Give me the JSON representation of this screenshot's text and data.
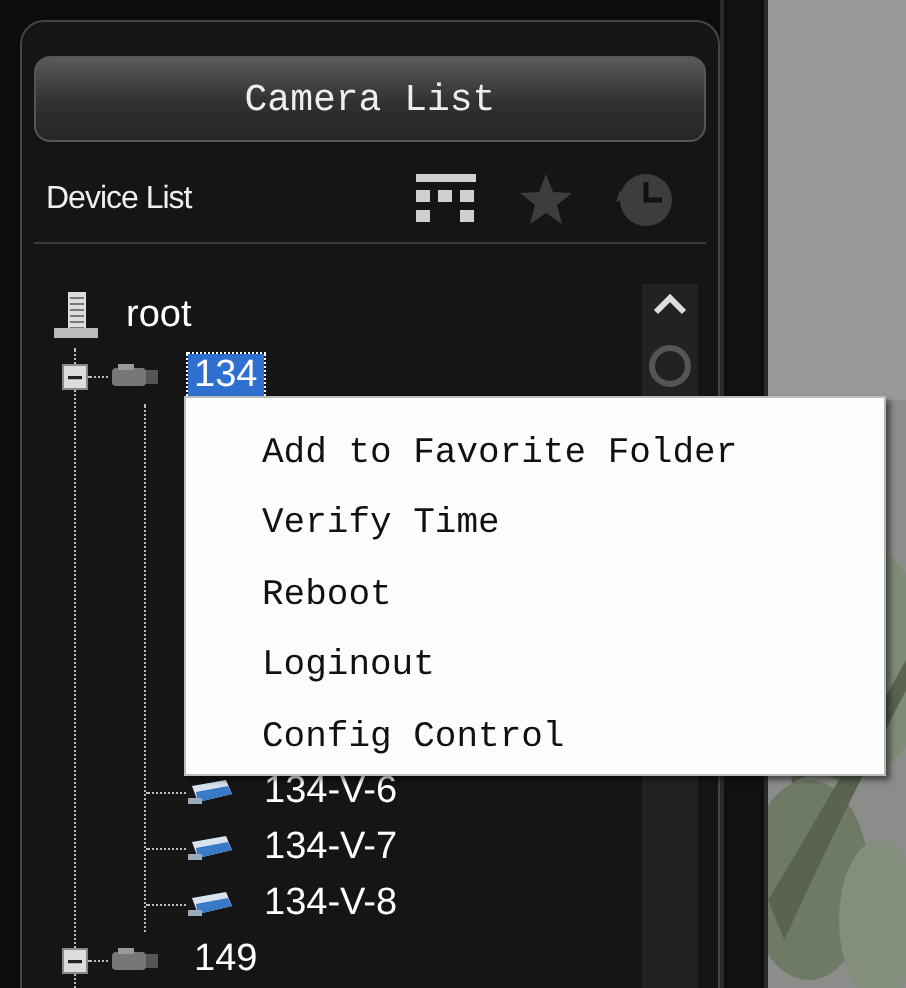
{
  "header_button": "Camera List",
  "device_list": {
    "title": "Device List",
    "views": [
      {
        "kind": "grid",
        "selected": true
      },
      {
        "kind": "star",
        "selected": false
      },
      {
        "kind": "clock",
        "selected": false
      }
    ]
  },
  "tree": [
    {
      "label": "root",
      "kind": "root",
      "selected": false,
      "children": [
        {
          "label": "134",
          "kind": "device",
          "expanded": true,
          "selected": true,
          "children": [
            {
              "label": "134-V-6",
              "kind": "channel",
              "selected": false
            },
            {
              "label": "134-V-7",
              "kind": "channel",
              "selected": false
            },
            {
              "label": "134-V-8",
              "kind": "channel",
              "selected": false
            }
          ]
        },
        {
          "label": "149",
          "kind": "device",
          "expanded": true,
          "selected": false
        }
      ]
    }
  ],
  "context_menu": [
    "Add to Favorite Folder",
    "Verify Time",
    "Reboot",
    "Loginout",
    "Config Control"
  ]
}
